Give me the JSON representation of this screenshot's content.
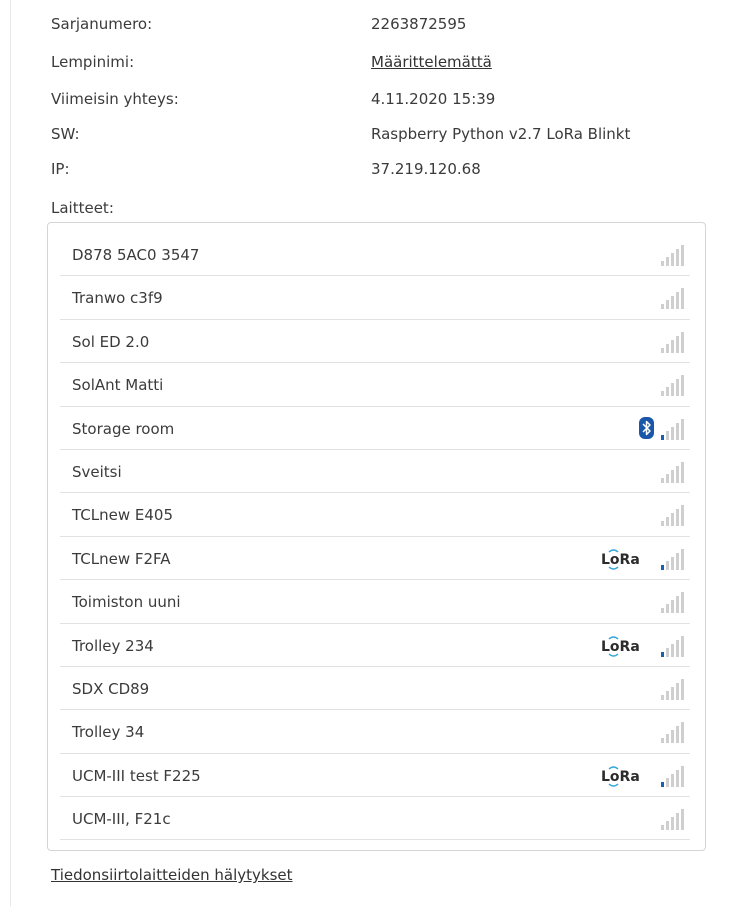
{
  "info": [
    {
      "label": "Sarjanumero:",
      "value": "2263872595",
      "link": false
    },
    {
      "label": "Lempinimi:",
      "value": "Määrittelemättä",
      "link": true
    },
    {
      "label": "Viimeisin yhteys:",
      "value": "4.11.2020 15:39",
      "link": false
    },
    {
      "label": "SW:",
      "value": "Raspberry Python v2.7 LoRa Blinkt",
      "link": false
    },
    {
      "label": "IP:",
      "value": "37.219.120.68",
      "link": false
    }
  ],
  "devices_label": "Laitteet:",
  "devices": [
    {
      "name": "D878 5AC0 3547",
      "badge": "",
      "signal_bars": 0
    },
    {
      "name": "Tranwo c3f9",
      "badge": "",
      "signal_bars": 0
    },
    {
      "name": "Sol ED 2.0",
      "badge": "",
      "signal_bars": 0
    },
    {
      "name": "SolAnt Matti",
      "badge": "",
      "signal_bars": 0
    },
    {
      "name": "Storage room",
      "badge": "bluetooth",
      "signal_bars": 1
    },
    {
      "name": "Sveitsi",
      "badge": "",
      "signal_bars": 0
    },
    {
      "name": "TCLnew E405",
      "badge": "",
      "signal_bars": 0
    },
    {
      "name": "TCLnew F2FA",
      "badge": "lora",
      "signal_bars": 1
    },
    {
      "name": "Toimiston uuni",
      "badge": "",
      "signal_bars": 0
    },
    {
      "name": "Trolley 234",
      "badge": "lora",
      "signal_bars": 1
    },
    {
      "name": "SDX CD89",
      "badge": "",
      "signal_bars": 0
    },
    {
      "name": "Trolley 34",
      "badge": "",
      "signal_bars": 0
    },
    {
      "name": "UCM-III test F225",
      "badge": "lora",
      "signal_bars": 1
    },
    {
      "name": "UCM-III, F21c",
      "badge": "",
      "signal_bars": 0
    }
  ],
  "lora_text": "LoRa",
  "footer_link": "Tiedonsiirtolaitteiden hälytykset",
  "colors": {
    "accent": "#1b5fb0",
    "bar_off": "#cfcfcf",
    "bluetooth": "#1a57a8"
  }
}
